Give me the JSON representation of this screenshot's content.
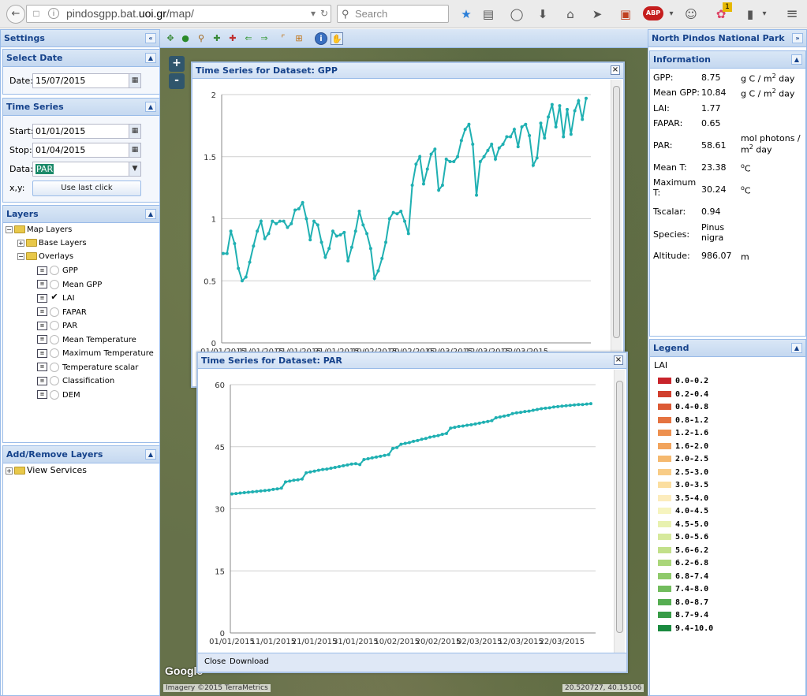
{
  "browser": {
    "url_prefix": "pindosgpp.bat.",
    "url_domain": "uoi.gr",
    "url_suffix": "/map/",
    "search_placeholder": "Search",
    "abp_label": "ABP",
    "badge": "1"
  },
  "settings": {
    "title": "Settings",
    "select_date": {
      "title": "Select Date",
      "date_label": "Date:",
      "date_value": "15/07/2015"
    },
    "time_series": {
      "title": "Time Series",
      "start_label": "Start:",
      "start_value": "01/01/2015",
      "stop_label": "Stop:",
      "stop_value": "01/04/2015",
      "data_label": "Data:",
      "data_value": "PAR",
      "xy_label": "x,y:",
      "use_last_click": "Use last click"
    },
    "layers": {
      "title": "Layers",
      "map_layers": "Map Layers",
      "base_layers": "Base Layers",
      "overlays": "Overlays",
      "items": [
        {
          "label": "GPP",
          "checked": false
        },
        {
          "label": "Mean GPP",
          "checked": false
        },
        {
          "label": "LAI",
          "checked": true
        },
        {
          "label": "FAPAR",
          "checked": false
        },
        {
          "label": "PAR",
          "checked": false
        },
        {
          "label": "Mean Temperature",
          "checked": false
        },
        {
          "label": "Maximum Temperature",
          "checked": false
        },
        {
          "label": "Temperature scalar",
          "checked": false
        },
        {
          "label": "Classification",
          "checked": false
        },
        {
          "label": "DEM",
          "checked": false
        }
      ]
    },
    "add_remove": {
      "title": "Add/Remove Layers",
      "view_services": "View Services"
    }
  },
  "map": {
    "zoom_in": "+",
    "zoom_out": "-",
    "attribution": "Imagery ©2015 TerraMetrics",
    "coords": "20.520727, 40.15106",
    "google": "Google"
  },
  "chart_windows": [
    {
      "title": "Time Series for Dataset: GPP"
    },
    {
      "title": "Time Series for Dataset: PAR",
      "close_label": "Close",
      "download_label": "Download"
    }
  ],
  "chart_data": [
    {
      "type": "line",
      "title": "Time Series for Dataset: GPP",
      "xlabel": "",
      "ylabel": "",
      "color": "#1fb0b2",
      "x_ticks": [
        "01/01/2015",
        "11/01/2015",
        "21/01/2015",
        "31/01/2015",
        "10/02/2015",
        "20/02/2015",
        "02/03/2015",
        "12/03/2015",
        "22/03/2015"
      ],
      "y_ticks": [
        "0",
        "0.5",
        "1",
        "1.5",
        "2"
      ],
      "ylim": [
        0,
        2
      ],
      "grid": true,
      "values": [
        0.72,
        0.72,
        0.9,
        0.8,
        0.6,
        0.5,
        0.53,
        0.65,
        0.78,
        0.9,
        0.98,
        0.84,
        0.88,
        0.98,
        0.96,
        0.98,
        0.98,
        0.93,
        0.96,
        1.07,
        1.08,
        1.13,
        1.0,
        0.83,
        0.98,
        0.95,
        0.81,
        0.69,
        0.76,
        0.9,
        0.86,
        0.87,
        0.89,
        0.66,
        0.77,
        0.9,
        1.06,
        0.95,
        0.88,
        0.76,
        0.52,
        0.58,
        0.68,
        0.81,
        1.0,
        1.05,
        1.04,
        1.06,
        0.98,
        0.88,
        1.27,
        1.44,
        1.5,
        1.28,
        1.4,
        1.52,
        1.56,
        1.23,
        1.27,
        1.48,
        1.46,
        1.46,
        1.5,
        1.63,
        1.72,
        1.76,
        1.6,
        1.19,
        1.46,
        1.5,
        1.55,
        1.6,
        1.48,
        1.57,
        1.6,
        1.66,
        1.66,
        1.72,
        1.58,
        1.74,
        1.76,
        1.67,
        1.43,
        1.49,
        1.77,
        1.65,
        1.82,
        1.92,
        1.74,
        1.91,
        1.66,
        1.88,
        1.68,
        1.87,
        1.95,
        1.8,
        1.97
      ]
    },
    {
      "type": "line",
      "title": "Time Series for Dataset: PAR",
      "xlabel": "",
      "ylabel": "",
      "color": "#1fb0b2",
      "x_ticks": [
        "01/01/2015",
        "11/01/2015",
        "21/01/2015",
        "31/01/2015",
        "10/02/2015",
        "20/02/2015",
        "02/03/2015",
        "12/03/2015",
        "22/03/2015"
      ],
      "y_ticks": [
        "0",
        "15",
        "30",
        "45",
        "60"
      ],
      "ylim": [
        0,
        60
      ],
      "grid": true,
      "values": [
        33.6,
        33.7,
        33.8,
        33.9,
        34.0,
        34.1,
        34.2,
        34.3,
        34.4,
        34.5,
        34.7,
        34.8,
        35.0,
        36.5,
        36.7,
        36.9,
        37.0,
        37.2,
        38.7,
        38.9,
        39.1,
        39.3,
        39.5,
        39.6,
        39.8,
        40.0,
        40.2,
        40.4,
        40.6,
        40.8,
        40.9,
        40.7,
        41.9,
        42.1,
        42.3,
        42.5,
        42.7,
        42.9,
        43.1,
        44.6,
        44.8,
        45.6,
        45.8,
        46.0,
        46.3,
        46.5,
        46.8,
        47.0,
        47.3,
        47.5,
        47.7,
        48.0,
        48.2,
        49.5,
        49.7,
        49.9,
        50.0,
        50.2,
        50.3,
        50.5,
        50.7,
        50.9,
        51.1,
        51.3,
        52.0,
        52.2,
        52.4,
        52.6,
        53.0,
        53.2,
        53.3,
        53.5,
        53.6,
        53.8,
        54.0,
        54.2,
        54.3,
        54.4,
        54.6,
        54.7,
        54.8,
        54.9,
        55.0,
        55.1,
        55.2,
        55.2,
        55.3,
        55.4
      ]
    }
  ],
  "north_pindos": {
    "title": "North Pindos National Park",
    "information_title": "Information",
    "rows": [
      {
        "label": "GPP:",
        "value": "8.75",
        "unit": "g C / m",
        "sup": "2",
        "unit_after": " day"
      },
      {
        "label": "Mean GPP:",
        "value": "10.84",
        "unit": "g C / m",
        "sup": "2",
        "unit_after": " day"
      },
      {
        "label": "LAI:",
        "value": "1.77",
        "unit": "",
        "sup": "",
        "unit_after": ""
      },
      {
        "label": "FAPAR:",
        "value": "0.65",
        "unit": "",
        "sup": "",
        "unit_after": ""
      },
      {
        "label": "PAR:",
        "value": "58.61",
        "unit": "mol photons / m",
        "sup": "2",
        "unit_after": " day"
      },
      {
        "label": "Mean T:",
        "value": "23.38",
        "unit": "",
        "sup": "o",
        "unit_after": "C"
      },
      {
        "label": "Maximum T:",
        "value": "30.24",
        "unit": "",
        "sup": "o",
        "unit_after": "C"
      },
      {
        "label": "Tscalar:",
        "value": "0.94",
        "unit": "",
        "sup": "",
        "unit_after": ""
      },
      {
        "label": "Species:",
        "value": "Pinus nigra",
        "unit": "",
        "sup": "",
        "unit_after": ""
      },
      {
        "label": "Altitude:",
        "value": "986.07",
        "unit": "m",
        "sup": "",
        "unit_after": ""
      }
    ],
    "legend_title": "Legend",
    "legend_layer": "LAI",
    "legend": [
      {
        "label": "0.0-0.2",
        "color": "#c8242b"
      },
      {
        "label": "0.2-0.4",
        "color": "#d13f2e"
      },
      {
        "label": "0.4-0.8",
        "color": "#dc5a35"
      },
      {
        "label": "0.8-1.2",
        "color": "#e57340"
      },
      {
        "label": "1.2-1.6",
        "color": "#ed904f"
      },
      {
        "label": "1.6-2.0",
        "color": "#f2a45d"
      },
      {
        "label": "2.0-2.5",
        "color": "#f5b96f"
      },
      {
        "label": "2.5-3.0",
        "color": "#f8cc86"
      },
      {
        "label": "3.0-3.5",
        "color": "#fbdea0"
      },
      {
        "label": "3.5-4.0",
        "color": "#fcecbd"
      },
      {
        "label": "4.0-4.5",
        "color": "#f6f4bf"
      },
      {
        "label": "4.5-5.0",
        "color": "#e8f1b0"
      },
      {
        "label": "5.0-5.6",
        "color": "#d6e99c"
      },
      {
        "label": "5.6-6.2",
        "color": "#c2e08a"
      },
      {
        "label": "6.2-6.8",
        "color": "#aad67a"
      },
      {
        "label": "6.8-7.4",
        "color": "#8fca6b"
      },
      {
        "label": "7.4-8.0",
        "color": "#72bc5d"
      },
      {
        "label": "8.0-8.7",
        "color": "#55ad51"
      },
      {
        "label": "8.7-9.4",
        "color": "#389c47"
      },
      {
        "label": "9.4-10.0",
        "color": "#1a8a3f"
      }
    ]
  }
}
